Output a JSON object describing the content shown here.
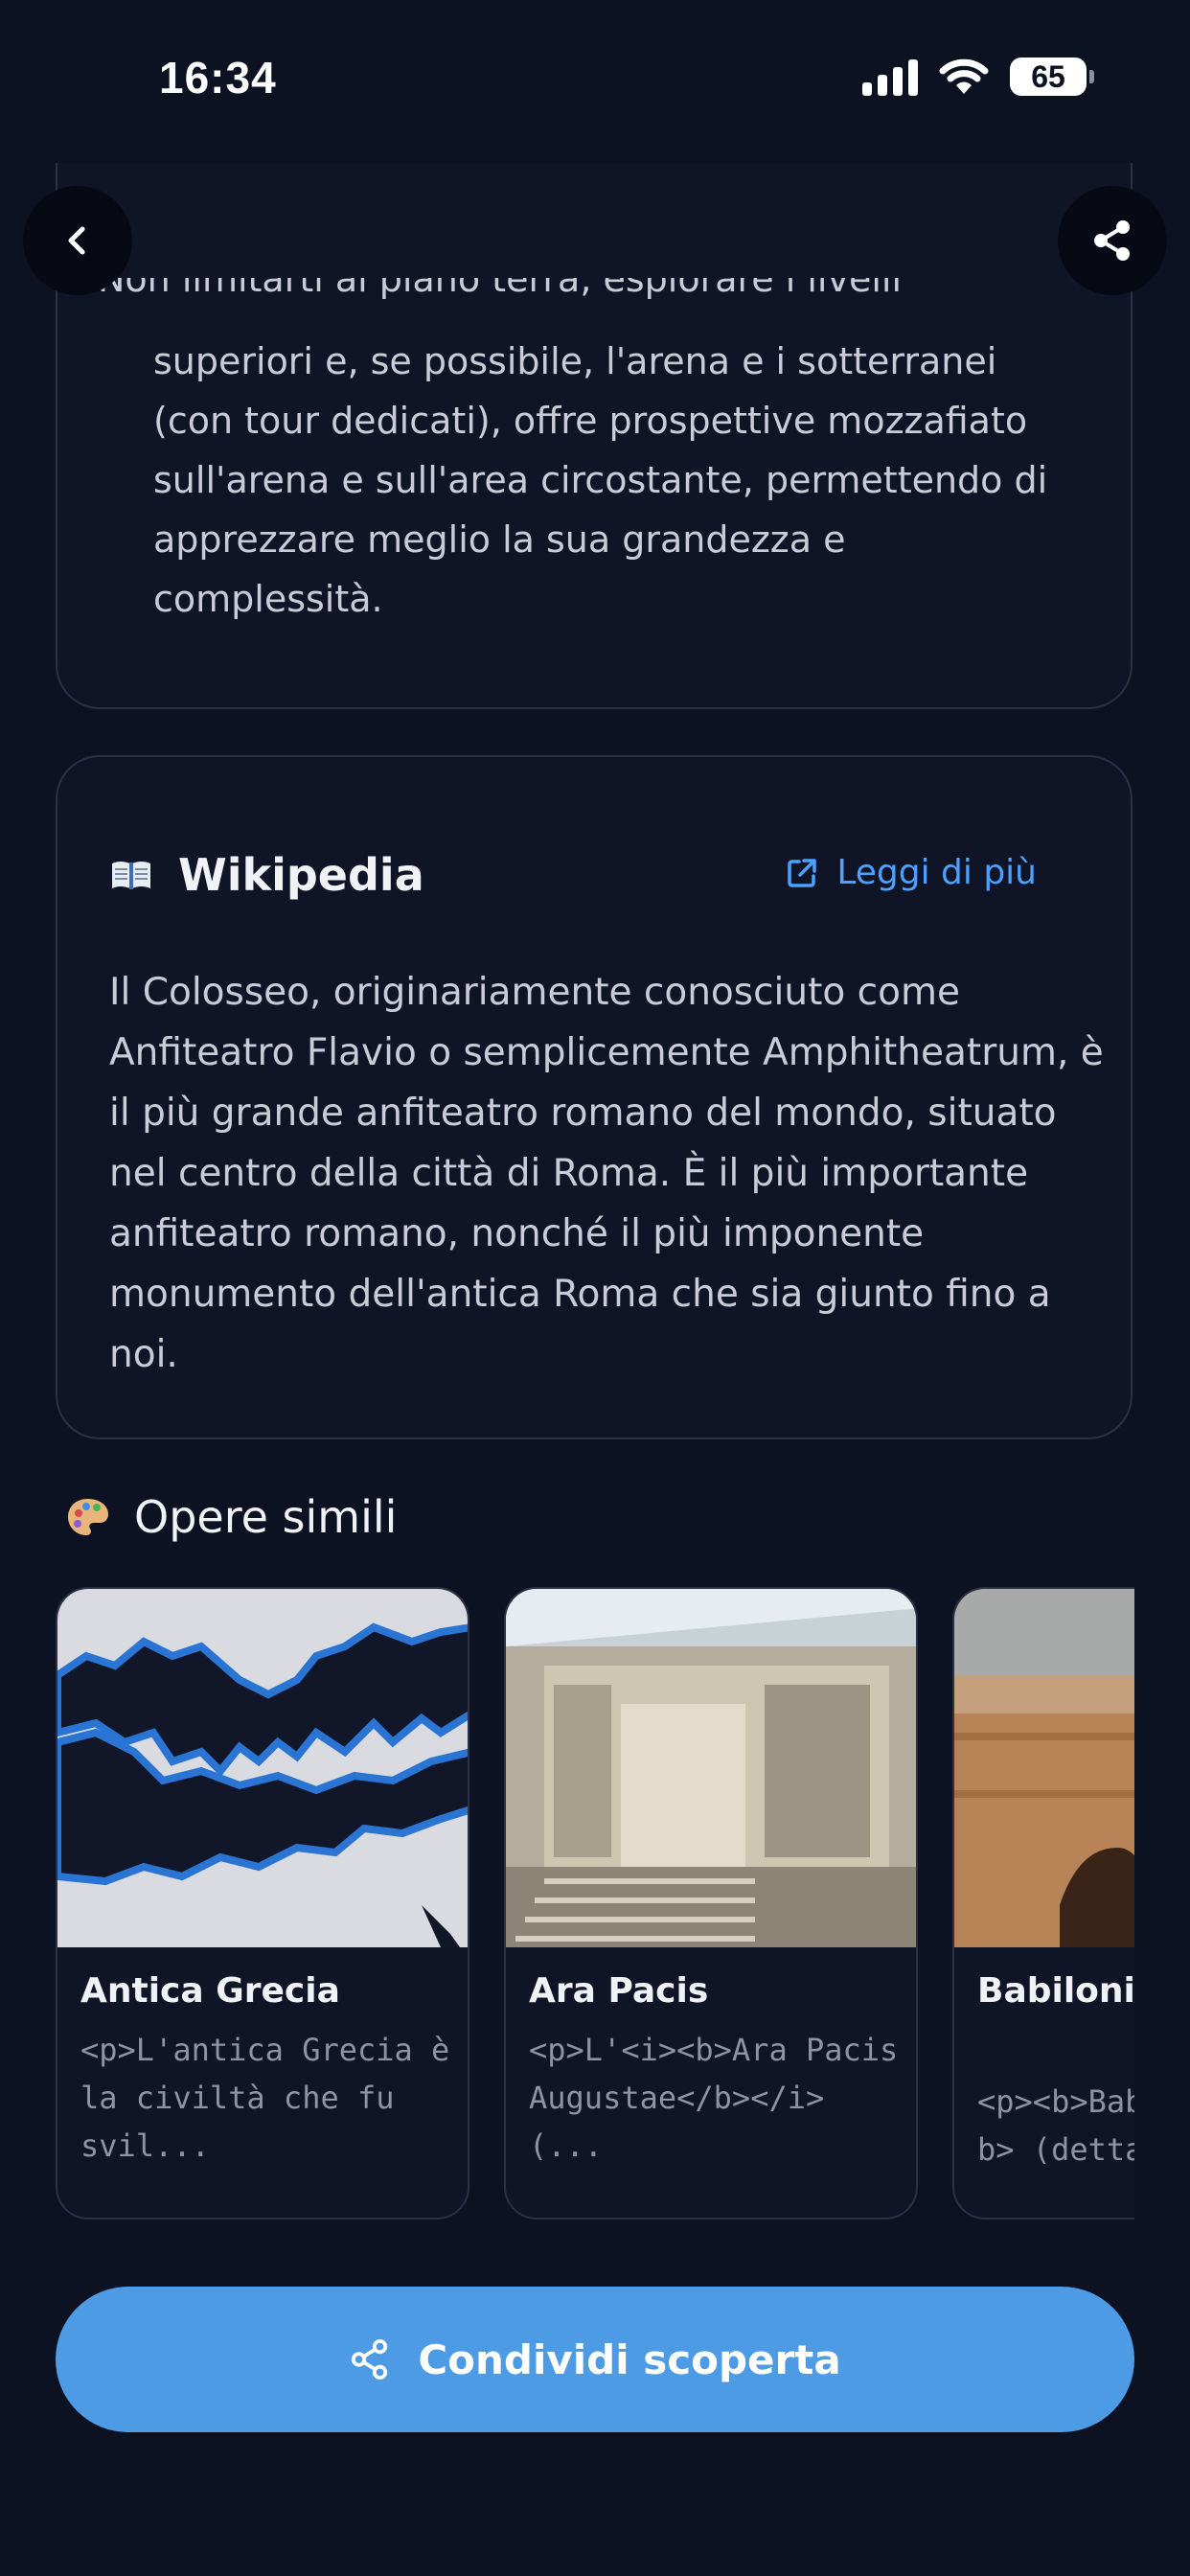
{
  "status_bar": {
    "time": "16:34",
    "battery": "65"
  },
  "nav": {
    "back_icon": "chevron-left-icon",
    "share_icon": "share-icon"
  },
  "tips": {
    "cut_line": "Non limitarti al piano terra, esplorare i livelli",
    "text": "superiori e, se possibile, l'arena e i sotterranei (con tour dedicati), offre prospettive mozzafiato sull'arena e sull'area circostante, permettendo di apprezzare meglio la sua grandezza e complessità."
  },
  "wikipedia": {
    "icon": "open-book-icon",
    "title": "Wikipedia",
    "link_icon": "external-link-icon",
    "link_label": "Leggi di più",
    "text": "Il Colosseo, originariamente conosciuto come Anfiteatro Flavio o semplicemente Amphitheatrum, è il più grande anfiteatro romano del mondo, situato nel centro della città di Roma. È il più importante anfiteatro romano, nonché il più imponente monumento dell'antica Roma che sia giunto fino a noi."
  },
  "similar": {
    "icon": "palette-icon",
    "title": "Opere simili",
    "items": [
      {
        "name": "Antica Grecia",
        "desc": "<p>L'antica Grecia è\nla civiltà che fu svil..."
      },
      {
        "name": "Ara Pacis",
        "desc": "<p>L'<i><b>Ara Pacis\nAugustae</b></i> (..."
      },
      {
        "name": "Babilonia (antica)",
        "desc": "<p><b>Babilonia</\nb> (detta"
      }
    ]
  },
  "cta": {
    "icon": "share-icon",
    "label": "Condividi scoperta"
  },
  "colors": {
    "background": "#0d1222",
    "accent": "#4d9be4",
    "link": "#4ca0ff"
  }
}
